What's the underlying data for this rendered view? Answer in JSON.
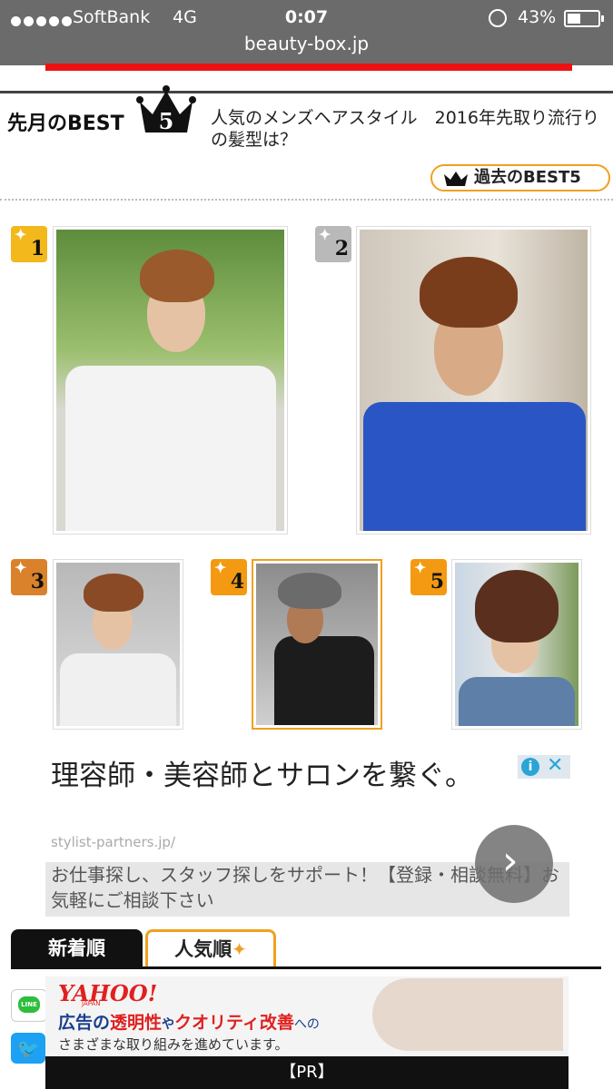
{
  "status_bar": {
    "carrier": "SoftBank",
    "network": "4G",
    "time": "0:07",
    "battery_percent": "43%",
    "battery_level": 0.43,
    "url": "beauty-box.jp"
  },
  "best": {
    "title": "先月のBEST",
    "crown_number": "5",
    "article_title": "人気のメンズヘアスタイル　2016年先取り流行りの髪型は？",
    "past_button": "過去のBEST5",
    "ranks": [
      {
        "number": "1",
        "color": "#f2b81c"
      },
      {
        "number": "2",
        "color": "#b9b9b9"
      },
      {
        "number": "3",
        "color": "#d9822b"
      },
      {
        "number": "4",
        "color": "#f39a12"
      },
      {
        "number": "5",
        "color": "#f39a12"
      }
    ]
  },
  "ad": {
    "headline": "理容師・美容師とサロンを繋ぐ。",
    "url": "stylist-partners.jp/",
    "description": "お仕事探し、スタッフ探しをサポート！【登録・相談無料】お気軽にご相談下さい",
    "choice_info": "i",
    "choice_close": "✕",
    "next": "›"
  },
  "tabs": {
    "new": "新着順",
    "popular": "人気順",
    "popular_icon": "✦"
  },
  "share": {
    "line": "LINE",
    "twitter": "🐦"
  },
  "ad2": {
    "logo": "YAHOO!",
    "logo_sub": "JAPAN",
    "line1_parts": [
      "広告の",
      "透明性",
      "や",
      "クオリティ改善",
      "への"
    ],
    "line2": "さまざまな取り組みを進めています。",
    "pr": "【PR】"
  },
  "colors": {
    "accent": "#f0a020",
    "status_bar": "#6b6b6b",
    "top_strip": "#ee1111"
  }
}
